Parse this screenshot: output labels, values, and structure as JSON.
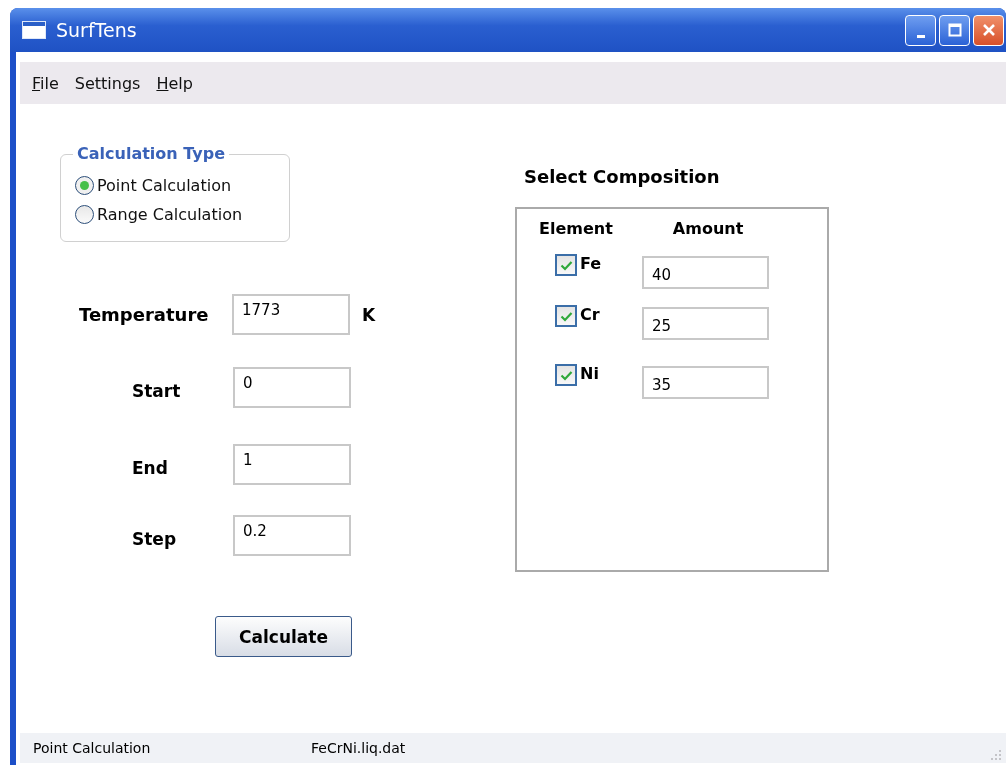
{
  "window": {
    "title": "SurfTens"
  },
  "menu": [
    {
      "label": "File",
      "underline_first": true
    },
    {
      "label": "Settings",
      "underline_first": false
    },
    {
      "label": "Help",
      "underline_first": true
    }
  ],
  "calculation_type": {
    "title": "Calculation Type",
    "options": [
      {
        "label": "Point Calculation",
        "selected": true
      },
      {
        "label": "Range Calculation",
        "selected": false
      }
    ]
  },
  "temperature": {
    "label": "Temperature",
    "value": "1773",
    "unit": "K"
  },
  "range_fields": [
    {
      "label": "Start",
      "value": "0"
    },
    {
      "label": "End",
      "value": "1"
    },
    {
      "label": "Step",
      "value": "0.2"
    }
  ],
  "calculate_button": "Calculate",
  "composition": {
    "title": "Select Composition",
    "columns": [
      "Element",
      "Amount"
    ],
    "elements": [
      {
        "symbol": "Fe",
        "checked": true,
        "amount": "40"
      },
      {
        "symbol": "Cr",
        "checked": true,
        "amount": "25"
      },
      {
        "symbol": "Ni",
        "checked": true,
        "amount": "35"
      }
    ]
  },
  "status_bar": [
    "Point Calculation",
    "FeCrNi.liq.dat"
  ]
}
